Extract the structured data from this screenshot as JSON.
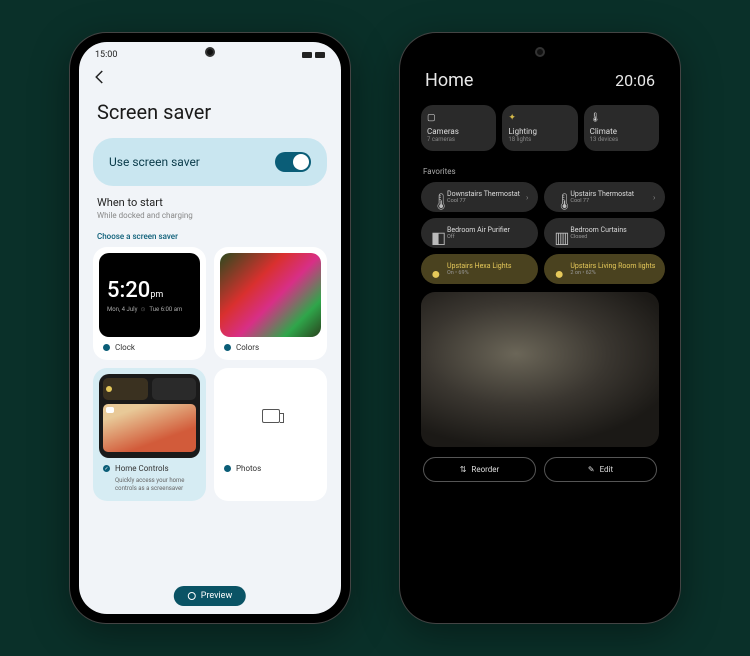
{
  "left": {
    "status_time": "15:00",
    "title": "Screen saver",
    "toggle_label": "Use screen saver",
    "when": {
      "title": "When to start",
      "sub": "While docked and charging"
    },
    "choose_label": "Choose a screen saver",
    "clock": {
      "label": "Clock",
      "time": "5:20",
      "ampm": "pm",
      "date": "Mon, 4 July",
      "alarm": "Tue 6:00 am"
    },
    "colors": {
      "label": "Colors"
    },
    "home": {
      "label": "Home Controls",
      "sub": "Quickly access your home controls as a screensaver"
    },
    "photos": {
      "label": "Photos"
    },
    "preview_btn": "Preview"
  },
  "right": {
    "title": "Home",
    "time": "20:06",
    "tiles": [
      {
        "icon": "camera",
        "label": "Cameras",
        "sub": "7 cameras"
      },
      {
        "icon": "bulb",
        "label": "Lighting",
        "sub": "18 lights"
      },
      {
        "icon": "thermo",
        "label": "Climate",
        "sub": "13 devices"
      }
    ],
    "fav_label": "Favorites",
    "favs": [
      {
        "icon": "thermo",
        "label": "Downstairs Thermostat",
        "sub": "Cool 77",
        "chev": true
      },
      {
        "icon": "thermo",
        "label": "Upstairs Thermostat",
        "sub": "Cool 77",
        "chev": true
      },
      {
        "icon": "purifier",
        "label": "Bedroom Air Purifier",
        "sub": "Off"
      },
      {
        "icon": "curtain",
        "label": "Bedroom Curtains",
        "sub": "Closed"
      },
      {
        "icon": "bulb",
        "label": "Upstairs Hexa Lights",
        "sub": "On • 69%",
        "lit": true
      },
      {
        "icon": "bulb",
        "label": "Upstairs Living Room lights",
        "sub": "2 on • 62%",
        "lit": true
      }
    ],
    "reorder": "Reorder",
    "edit": "Edit"
  }
}
